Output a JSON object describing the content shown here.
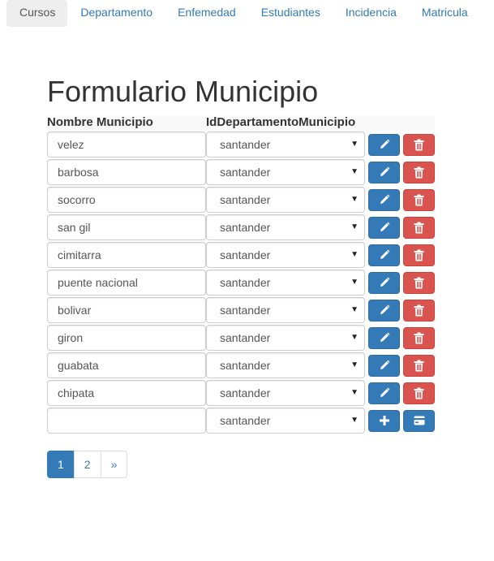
{
  "nav": {
    "tabs": [
      {
        "label": "Cursos"
      },
      {
        "label": "Departamento"
      },
      {
        "label": "Enfemedad"
      },
      {
        "label": "Estudiantes"
      },
      {
        "label": "Incidencia"
      },
      {
        "label": "Matricula"
      }
    ]
  },
  "form": {
    "title": "Formulario Municipio",
    "headers": {
      "name": "Nombre Municipio",
      "dept": "IdDepartamentoMunicipio"
    },
    "rows": [
      {
        "name": "velez",
        "dept": "santander"
      },
      {
        "name": "barbosa",
        "dept": "santander"
      },
      {
        "name": "socorro",
        "dept": "santander"
      },
      {
        "name": "san gil",
        "dept": "santander"
      },
      {
        "name": "cimitarra",
        "dept": "santander"
      },
      {
        "name": "puente nacional",
        "dept": "santander"
      },
      {
        "name": "bolivar",
        "dept": "santander"
      },
      {
        "name": "giron",
        "dept": "santander"
      },
      {
        "name": "guabata",
        "dept": "santander"
      },
      {
        "name": "chipata",
        "dept": "santander"
      }
    ],
    "new_row": {
      "name": "",
      "dept": "santander"
    }
  },
  "pagination": {
    "pages": [
      "1",
      "2",
      "»"
    ],
    "active": "1"
  },
  "colors": {
    "primary": "#337ab7",
    "danger": "#d9534f"
  }
}
